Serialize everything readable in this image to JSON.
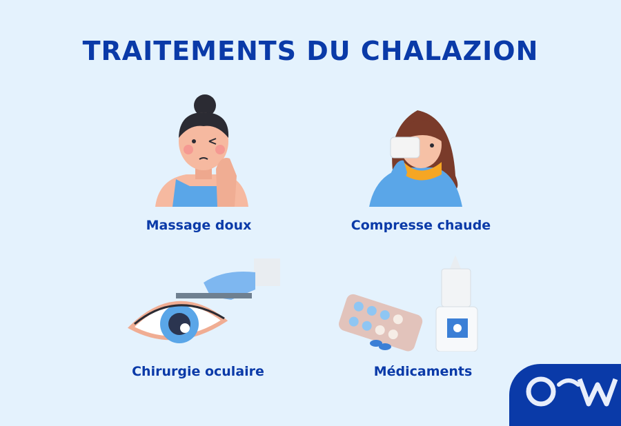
{
  "title": "TRAITEMENTS DU CHALAZION",
  "items": [
    {
      "label": "Massage doux",
      "icon": "woman-massaging-eye"
    },
    {
      "label": "Compresse chaude",
      "icon": "woman-warm-compress"
    },
    {
      "label": "Chirurgie oculaire",
      "icon": "eye-scalpel"
    },
    {
      "label": "Médicaments",
      "icon": "pills-eye-drops"
    }
  ],
  "logo": {
    "text": "O⌢W"
  },
  "colors": {
    "background": "#e4f2fd",
    "accent": "#0a3aa8"
  }
}
